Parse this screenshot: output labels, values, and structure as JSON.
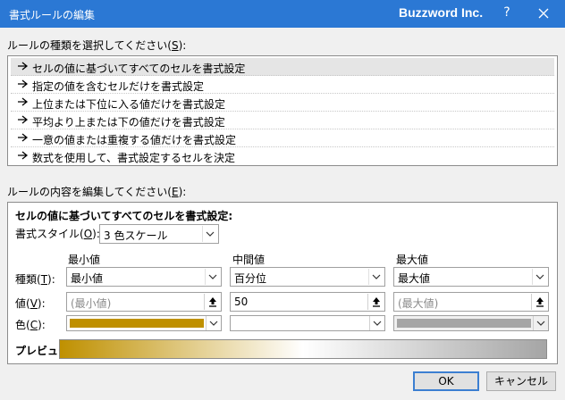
{
  "window": {
    "title": "書式ルールの編集",
    "brand": "Buzzword Inc.",
    "help": "?"
  },
  "rule_type": {
    "label_prefix": "ルールの種類を選択してください(",
    "accesskey": "S",
    "label_suffix": "):",
    "items": [
      {
        "label": "セルの値に基づいてすべてのセルを書式設定",
        "selected": true
      },
      {
        "label": "指定の値を含むセルだけを書式設定",
        "selected": false
      },
      {
        "label": "上位または下位に入る値だけを書式設定",
        "selected": false
      },
      {
        "label": "平均より上または下の値だけを書式設定",
        "selected": false
      },
      {
        "label": "一意の値または重複する値だけを書式設定",
        "selected": false
      },
      {
        "label": "数式を使用して、書式設定するセルを決定",
        "selected": false
      }
    ]
  },
  "rule_edit": {
    "label_prefix": "ルールの内容を編集してください(",
    "accesskey": "E",
    "label_suffix": "):",
    "heading": "セルの値に基づいてすべてのセルを書式設定:",
    "style_label_prefix": "書式スタイル(",
    "style_accesskey": "O",
    "style_label_suffix": "):",
    "style_value": "3 色スケール",
    "row_labels": {
      "type_prefix": "種類(",
      "type_key": "T",
      "type_suffix": "):",
      "value_prefix": "値(",
      "value_key": "V",
      "value_suffix": "):",
      "color_prefix": "色(",
      "color_key": "C",
      "color_suffix": "):"
    },
    "columns": [
      {
        "header": "最小値",
        "type": "最小値",
        "value": "(最小値)",
        "value_dim": true,
        "value_enabled": false,
        "color": "#bf9000",
        "color_enabled": true
      },
      {
        "header": "中間値",
        "type": "百分位",
        "value": "50",
        "value_dim": false,
        "value_enabled": true,
        "color": "#ffffff",
        "color_enabled": true
      },
      {
        "header": "最大値",
        "type": "最大値",
        "value": "(最大値)",
        "value_dim": true,
        "value_enabled": false,
        "color": "#a5a5a5",
        "color_enabled": false
      }
    ],
    "preview_label": "プレビュー:",
    "preview_colors": [
      "#bf9000",
      "#ffffff",
      "#a5a5a5"
    ]
  },
  "buttons": {
    "ok": "OK",
    "cancel": "キャンセル"
  },
  "colors": {
    "titlebar": "#2b78d4",
    "selection": "#e5e5e5",
    "default_button_border": "#3c7fd1"
  }
}
